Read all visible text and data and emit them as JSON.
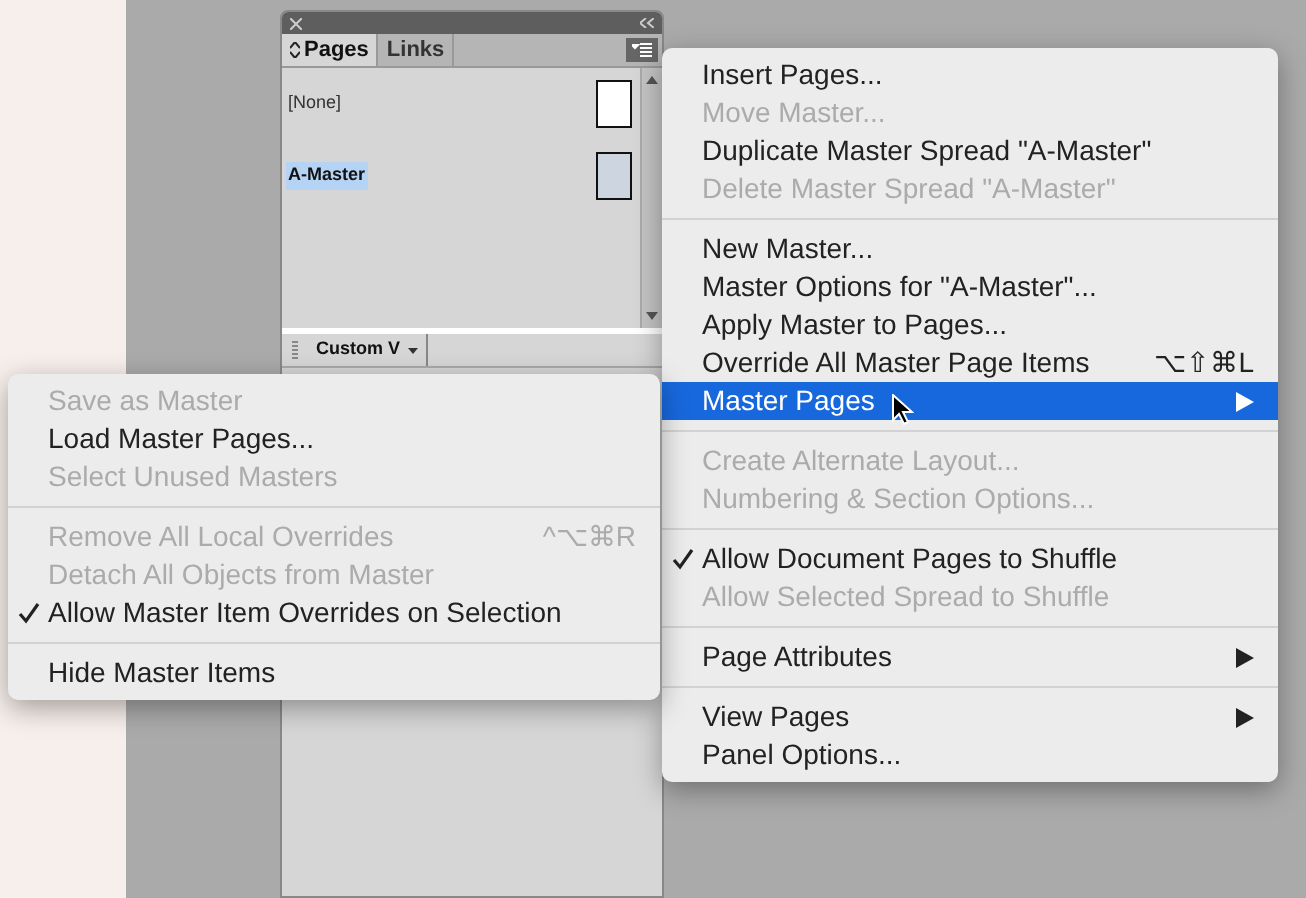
{
  "panel": {
    "tabs": [
      {
        "label": "Pages",
        "selected": true
      },
      {
        "label": "Links",
        "selected": false
      }
    ],
    "masters": [
      {
        "name": "[None]",
        "selected": false
      },
      {
        "name": "A-Master",
        "selected": true
      }
    ],
    "view_menu": "Custom V"
  },
  "menu": {
    "items": [
      {
        "kind": "item",
        "label": "Insert Pages...",
        "disabled": false,
        "checked": false,
        "selected": false
      },
      {
        "kind": "item",
        "label": "Move Master...",
        "disabled": true,
        "checked": false,
        "selected": false
      },
      {
        "kind": "item",
        "label": "Duplicate Master Spread \"A-Master\"",
        "disabled": false,
        "checked": false,
        "selected": false
      },
      {
        "kind": "item",
        "label": "Delete Master Spread \"A-Master\"",
        "disabled": true,
        "checked": false,
        "selected": false
      },
      {
        "kind": "separator"
      },
      {
        "kind": "item",
        "label": "New Master...",
        "disabled": false,
        "checked": false,
        "selected": false
      },
      {
        "kind": "item",
        "label": "Master Options for \"A-Master\"...",
        "disabled": false,
        "checked": false,
        "selected": false
      },
      {
        "kind": "item",
        "label": "Apply Master to Pages...",
        "disabled": false,
        "checked": false,
        "selected": false
      },
      {
        "kind": "item",
        "label": "Override All Master Page Items",
        "shortcut": "⌥⇧⌘L",
        "disabled": false,
        "checked": false,
        "selected": false
      },
      {
        "kind": "submenu",
        "label": "Master Pages",
        "disabled": false,
        "checked": false,
        "selected": true
      },
      {
        "kind": "separator"
      },
      {
        "kind": "item",
        "label": "Create Alternate Layout...",
        "disabled": true,
        "checked": false,
        "selected": false
      },
      {
        "kind": "item",
        "label": "Numbering & Section Options...",
        "disabled": true,
        "checked": false,
        "selected": false
      },
      {
        "kind": "separator"
      },
      {
        "kind": "item",
        "label": "Allow Document Pages to Shuffle",
        "disabled": false,
        "checked": true,
        "selected": false
      },
      {
        "kind": "item",
        "label": "Allow Selected Spread to Shuffle",
        "disabled": true,
        "checked": false,
        "selected": false
      },
      {
        "kind": "separator"
      },
      {
        "kind": "submenu",
        "label": "Page Attributes",
        "disabled": false,
        "checked": false,
        "selected": false
      },
      {
        "kind": "separator"
      },
      {
        "kind": "submenu",
        "label": "View Pages",
        "disabled": false,
        "checked": false,
        "selected": false
      },
      {
        "kind": "item",
        "label": "Panel Options...",
        "disabled": false,
        "checked": false,
        "selected": false
      }
    ]
  },
  "submenu": {
    "items": [
      {
        "kind": "item",
        "label": "Save as Master",
        "disabled": true,
        "checked": false,
        "selected": false
      },
      {
        "kind": "item",
        "label": "Load Master Pages...",
        "disabled": false,
        "checked": false,
        "selected": false
      },
      {
        "kind": "item",
        "label": "Select Unused Masters",
        "disabled": true,
        "checked": false,
        "selected": false
      },
      {
        "kind": "separator"
      },
      {
        "kind": "item",
        "label": "Remove All Local Overrides",
        "shortcut": "^⌥⌘R",
        "disabled": true,
        "checked": false,
        "selected": false
      },
      {
        "kind": "item",
        "label": "Detach All Objects from Master",
        "disabled": true,
        "checked": false,
        "selected": false
      },
      {
        "kind": "item",
        "label": "Allow Master Item Overrides on Selection",
        "disabled": false,
        "checked": true,
        "selected": false
      },
      {
        "kind": "separator"
      },
      {
        "kind": "item",
        "label": "Hide Master Items",
        "disabled": false,
        "checked": false,
        "selected": false
      }
    ]
  }
}
